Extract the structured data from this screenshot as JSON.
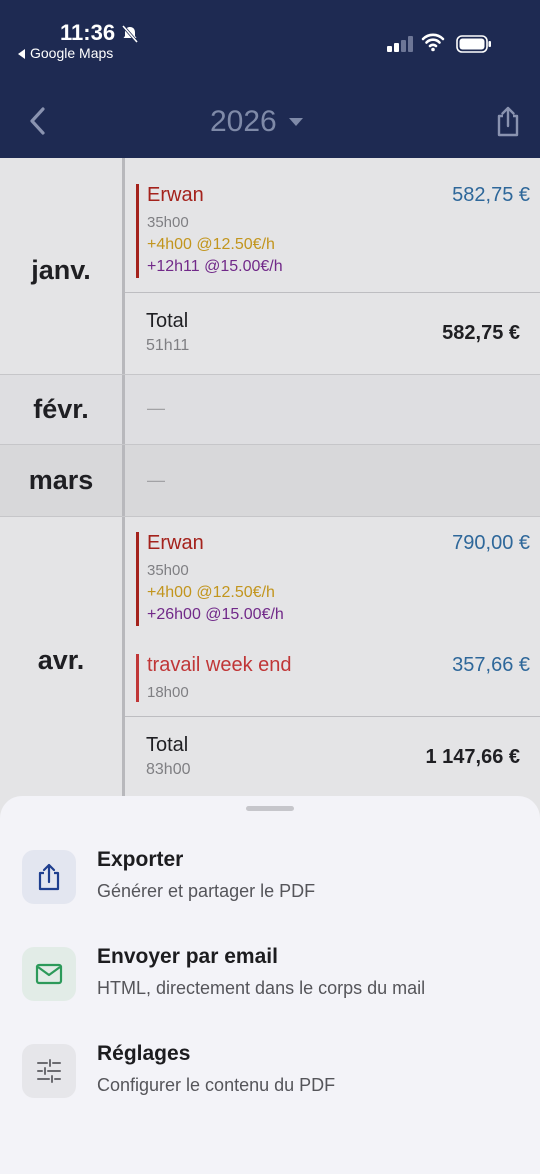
{
  "status": {
    "time": "11:36",
    "back_app": "Google Maps"
  },
  "header": {
    "year": "2026"
  },
  "months": [
    {
      "name": "janv.",
      "entries": [
        {
          "name": "Erwan",
          "amount": "582,75 €",
          "hours": "35h00",
          "ot1": "+4h00 @12.50€/h",
          "ot2": "+12h11 @15.00€/h"
        }
      ],
      "total": {
        "label": "Total",
        "hours": "51h11",
        "amount": "582,75 €"
      }
    },
    {
      "name": "févr.",
      "empty": "—"
    },
    {
      "name": "mars",
      "empty": "—"
    },
    {
      "name": "avr.",
      "entries": [
        {
          "name": "Erwan",
          "amount": "790,00 €",
          "hours": "35h00",
          "ot1": "+4h00 @12.50€/h",
          "ot2": "+26h00 @15.00€/h"
        },
        {
          "name": "travail week end",
          "amount": "357,66 €",
          "hours": "18h00"
        }
      ],
      "total": {
        "label": "Total",
        "hours": "83h00",
        "amount": "1 147,66 €"
      }
    }
  ],
  "sheet": {
    "items": [
      {
        "title": "Exporter",
        "desc": "Générer et partager le PDF",
        "icon": "share-icon"
      },
      {
        "title": "Envoyer par email",
        "desc": "HTML, directement dans le corps du mail",
        "icon": "mail-icon"
      },
      {
        "title": "Réglages",
        "desc": "Configurer le contenu du PDF",
        "icon": "sliders-icon"
      }
    ]
  },
  "colors": {
    "header_bg": "#1e2a52",
    "entry_name": "#b3221a",
    "amount_blue": "#2f6fa6",
    "overtime_gold": "#d4a21c",
    "overtime_purple": "#7a2a94"
  }
}
